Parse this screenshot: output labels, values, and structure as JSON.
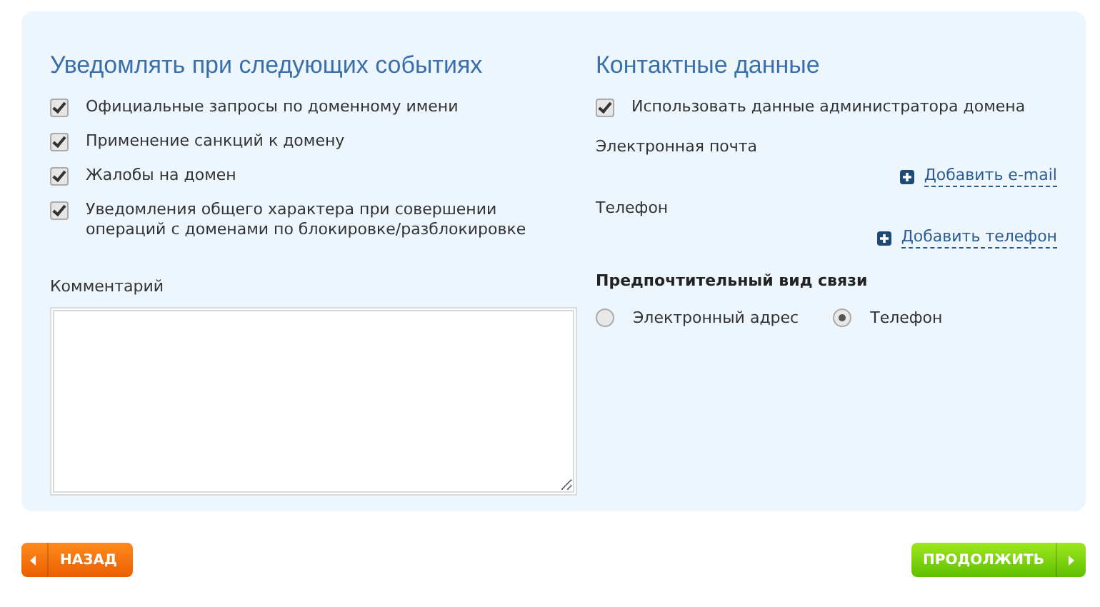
{
  "events": {
    "title": "Уведомлять при следующих событиях",
    "items": [
      {
        "label": "Официальные запросы по доменному имени",
        "checked": true
      },
      {
        "label": "Применение санкций к домену",
        "checked": true
      },
      {
        "label": "Жалобы на домен",
        "checked": true
      },
      {
        "label": "Уведомления общего характера при совершении операций с доменами по блокировке/разблокировке",
        "checked": true
      }
    ],
    "comment_label": "Комментарий"
  },
  "contacts": {
    "title": "Контактные данные",
    "use_admin": {
      "label": "Использовать данные администратора домена",
      "checked": true
    },
    "email_label": "Электронная почта",
    "add_email": "Добавить e-mail",
    "phone_label": "Телефон",
    "add_phone": "Добавить телефон",
    "preferred_title": "Предпочтительный вид связи",
    "preferred_options": [
      {
        "label": "Электронный адрес",
        "selected": false
      },
      {
        "label": "Телефон",
        "selected": true
      }
    ]
  },
  "buttons": {
    "back": "НАЗАД",
    "next": "ПРОДОЛЖИТЬ"
  }
}
